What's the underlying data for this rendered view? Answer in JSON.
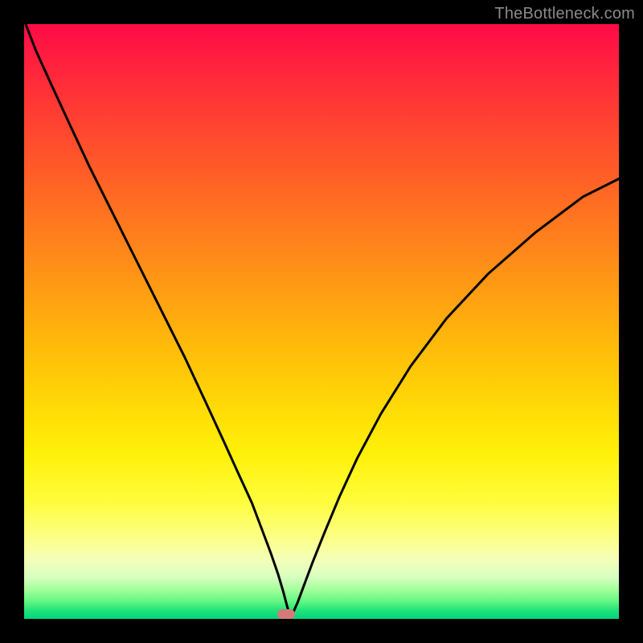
{
  "watermark_text": "TheBottleneck.com",
  "marker": {
    "x_frac": 0.44,
    "y_frac": 0.992
  },
  "chart_data": {
    "type": "line",
    "title": "",
    "xlabel": "",
    "ylabel": "",
    "xlim": [
      0,
      1
    ],
    "ylim": [
      0,
      1
    ],
    "note": "Axes are unlabeled; values are normalized fractions of the plot area. y=1 corresponds to the top edge (high bottleneck), y≈0 is the green optimum at the bottom. The curve is a V-shaped bottleneck profile with its minimum at x≈0.44.",
    "series": [
      {
        "name": "bottleneck-curve",
        "x": [
          0.0,
          0.02,
          0.045,
          0.075,
          0.11,
          0.15,
          0.19,
          0.23,
          0.27,
          0.305,
          0.335,
          0.36,
          0.383,
          0.4,
          0.415,
          0.427,
          0.436,
          0.442,
          0.446,
          0.452,
          0.46,
          0.47,
          0.485,
          0.505,
          0.53,
          0.56,
          0.6,
          0.65,
          0.71,
          0.78,
          0.86,
          0.94,
          1.0
        ],
        "y": [
          1.0,
          0.955,
          0.9,
          0.835,
          0.76,
          0.68,
          0.6,
          0.52,
          0.44,
          0.365,
          0.3,
          0.245,
          0.195,
          0.15,
          0.11,
          0.075,
          0.045,
          0.022,
          0.008,
          0.01,
          0.028,
          0.055,
          0.095,
          0.145,
          0.205,
          0.27,
          0.345,
          0.425,
          0.505,
          0.58,
          0.65,
          0.71,
          0.74
        ]
      }
    ],
    "background_gradient": {
      "0.00": "#ff0b46",
      "0.50": "#ffba0a",
      "0.80": "#fffc3a",
      "0.95": "#a6ff9c",
      "1.00": "#00d47d"
    },
    "optimum_marker": {
      "x": 0.44,
      "y": 0.0,
      "color": "#d37a7a"
    }
  }
}
